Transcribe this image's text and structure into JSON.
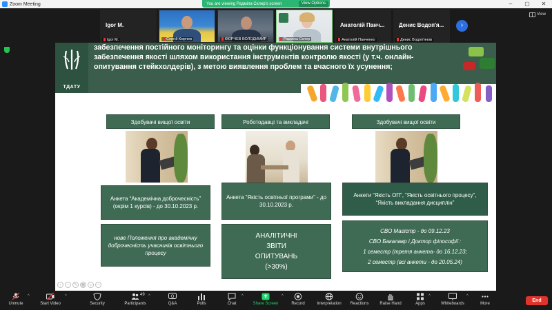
{
  "window": {
    "title": "Zoom Meeting"
  },
  "banner": {
    "text": "You are viewing Радміла Склер's screen",
    "view_options": "View Options"
  },
  "view_button": "View",
  "participants": [
    {
      "big_name": "Igor M.",
      "label": "Igor M.",
      "type": "name"
    },
    {
      "big_name": "",
      "label": "Сергій Кюрчев",
      "type": "video"
    },
    {
      "big_name": "",
      "label": "КЮРЧЕВ ВОЛОДИМИР",
      "type": "video"
    },
    {
      "big_name": "",
      "label": "Радміла Склер",
      "type": "video"
    },
    {
      "big_name": "Анатолій Панч...",
      "label": "Анатолій Панченко",
      "type": "name"
    },
    {
      "big_name": "Денис Водоп'я...",
      "label": "Денис Водоп'янов",
      "type": "name"
    }
  ],
  "slide": {
    "logo_text": "ТДАТУ",
    "header_text": "забезпечення постійного моніторингу та оцінки функціонування системи внутрішнього забезпечення якості шляхом використання інструментів контролю якості (у т.ч. онлайн-опитування стейкхолдерів), з метою виявлення проблем та вчасного їх усунення;",
    "columns": [
      {
        "title": "Здобувачі вищої освіти",
        "survey": "Анкета “Академічна доброчесність” (окрім 1 курсів) - до 30.10.2023 р.",
        "result": "нове Положення про академічну доброчесність учасників освітнього процесу"
      },
      {
        "title": "Роботодавці та викладачі",
        "survey": "Анкета “Якість освітньої програми” - до 30.10.2023 р.",
        "result_line1": "АНАЛІТИЧНІ",
        "result_line2": "ЗВІТИ",
        "result_line3": "ОПИТУВАНЬ",
        "result_line4": "(>30%)"
      },
      {
        "title": "Здобувачі вищої освіти",
        "survey": "Анкети “Якість ОП”, “Якість освітнього процесу”, “Якість викладання дисциплін”",
        "result_line1": "СВО Магістр - до 09.12.23",
        "result_line2": "СВО Бакалавр і Доктор філософії :",
        "result_line3": "1 семестр (третя анкета- до 16.12.23;",
        "result_line4": "2 семестр (всі анкети - до 20.05.24)"
      }
    ]
  },
  "toolbar": {
    "unmute": "Unmute",
    "start_video": "Start Video",
    "security": "Security",
    "participants": "Participants",
    "participants_count": "49",
    "qa": "Q&A",
    "polls": "Polls",
    "chat": "Chat",
    "share_screen": "Share Screen",
    "record": "Record",
    "interpretation": "Interpretation",
    "reactions": "Reactions",
    "raise_hand": "Raise Hand",
    "apps": "Apps",
    "whiteboards": "Whiteboards",
    "more": "More",
    "end": "End"
  },
  "colors": {
    "slide_green": "#3f6b55",
    "share_green": "#23d16c",
    "end_red": "#e0342b",
    "banner_green": "#2bb673"
  }
}
